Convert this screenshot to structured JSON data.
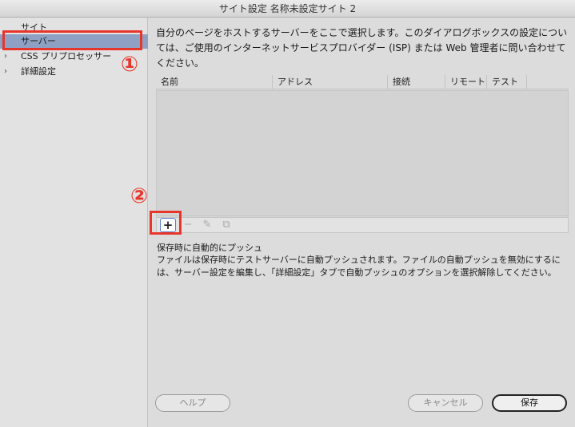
{
  "window": {
    "title": "サイト設定 名称未設定サイト 2"
  },
  "sidebar": {
    "items": [
      {
        "label": "サイト",
        "chevron": ""
      },
      {
        "label": "サーバー",
        "chevron": ""
      },
      {
        "label": "CSS プリプロセッサー",
        "chevron": "›"
      },
      {
        "label": "詳細設定",
        "chevron": "›"
      }
    ]
  },
  "annotations": {
    "step1": "①",
    "step2": "②"
  },
  "main": {
    "description": "自分のページをホストするサーバーをここで選択します。このダイアログボックスの設定については、ご使用のインターネットサービスプロバイダー (ISP) または Web 管理者に問い合わせてください。",
    "table": {
      "columns": [
        "名前",
        "アドレス",
        "接続",
        "リモート",
        "テスト"
      ],
      "rows": []
    },
    "toolbar": {
      "add": "+",
      "remove": "−",
      "edit": "✎",
      "duplicate": "⧉"
    },
    "push": {
      "title": "保存時に自動的にプッシュ",
      "description": "ファイルは保存時にテストサーバーに自動プッシュされます。ファイルの自動プッシュを無効にするには、サーバー設定を編集し、「詳細設定」タブで自動プッシュのオプションを選択解除してください。"
    }
  },
  "buttons": {
    "help": "ヘルプ",
    "cancel": "キャンセル",
    "save": "保存"
  },
  "colors": {
    "selected": "#8ea1c4",
    "annotation": "#e8352a",
    "focus": "#5b7fd1"
  }
}
